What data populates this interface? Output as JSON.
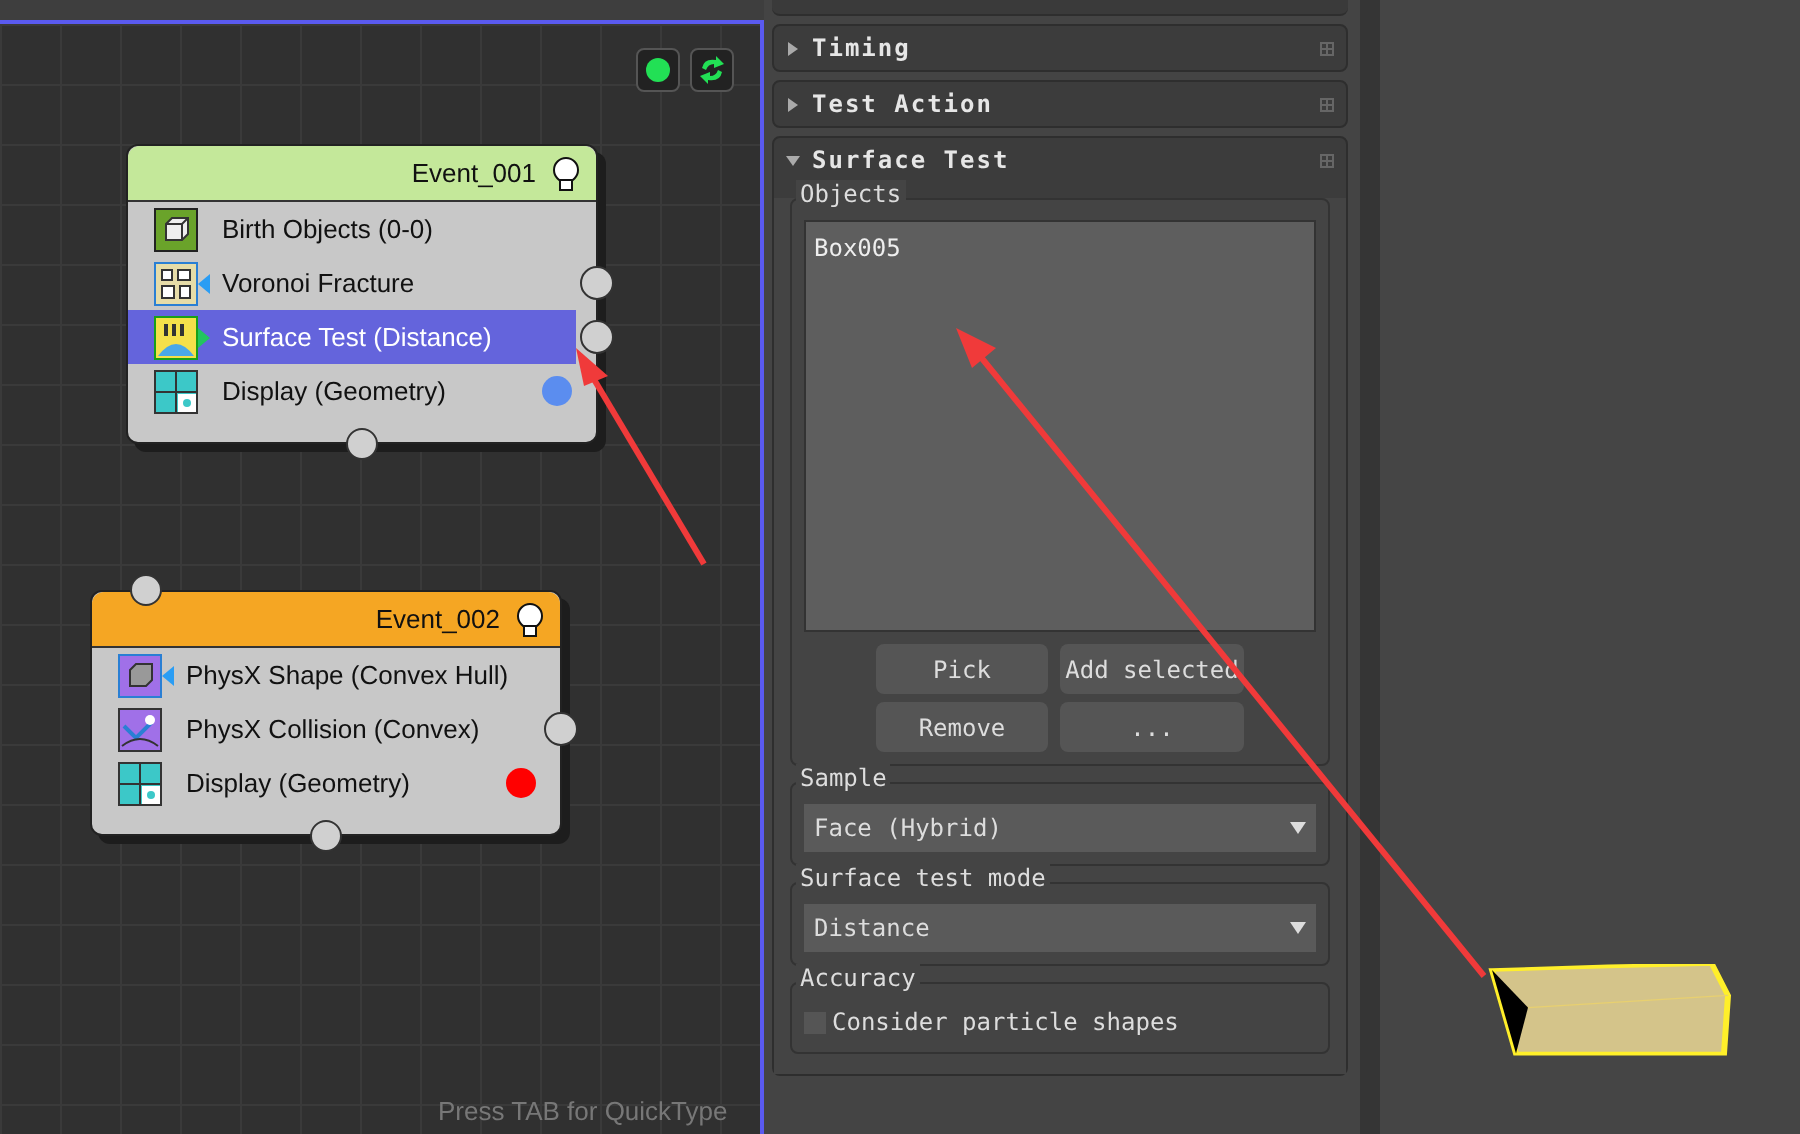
{
  "canvas": {
    "hint": "Press TAB for QuickType",
    "status_on": true
  },
  "events": [
    {
      "title": "Event_001",
      "color": "#c4e89a",
      "input_socket": false,
      "operators": [
        {
          "label": "Birth Objects (0-0)",
          "kind": "birth",
          "selected": false,
          "output": false
        },
        {
          "label": "Voronoi Fracture",
          "kind": "voronoi",
          "selected": false,
          "indicator": {
            "color": "#2a9df4"
          },
          "output": true
        },
        {
          "label": "Surface Test (Distance)",
          "kind": "surface_test",
          "selected": true,
          "indicator": {
            "color": "#22c55e"
          },
          "output": true
        },
        {
          "label": "Display (Geometry)",
          "kind": "display",
          "selected": false,
          "output": false,
          "dot": {
            "color": "#5b8def"
          }
        }
      ]
    },
    {
      "title": "Event_002",
      "color": "#f5a623",
      "input_socket": true,
      "operators": [
        {
          "label": "PhysX Shape (Convex Hull)",
          "kind": "physx_shape",
          "selected": false,
          "indicator": {
            "color": "#2a9df4"
          },
          "output": false
        },
        {
          "label": "PhysX Collision (Convex)",
          "kind": "physx_collision",
          "selected": false,
          "output": true
        },
        {
          "label": "Display (Geometry)",
          "kind": "display",
          "selected": false,
          "output": false,
          "dot": {
            "color": "#ff0000"
          }
        }
      ]
    }
  ],
  "rollouts": [
    {
      "title": "Timing",
      "expanded": false
    },
    {
      "title": "Test Action",
      "expanded": false
    },
    {
      "title": "Surface Test",
      "expanded": true
    }
  ],
  "surface_test": {
    "objects": {
      "label": "Objects",
      "items": [
        "Box005"
      ],
      "buttons": [
        "Pick",
        "Add selected",
        "Remove",
        "..."
      ]
    },
    "sample": {
      "label": "Sample",
      "value": "Face (Hybrid)"
    },
    "mode": {
      "label": "Surface test mode",
      "value": "Distance"
    },
    "accuracy": {
      "label": "Accuracy",
      "checkbox": {
        "label": "Consider particle shapes",
        "checked": false
      }
    }
  }
}
